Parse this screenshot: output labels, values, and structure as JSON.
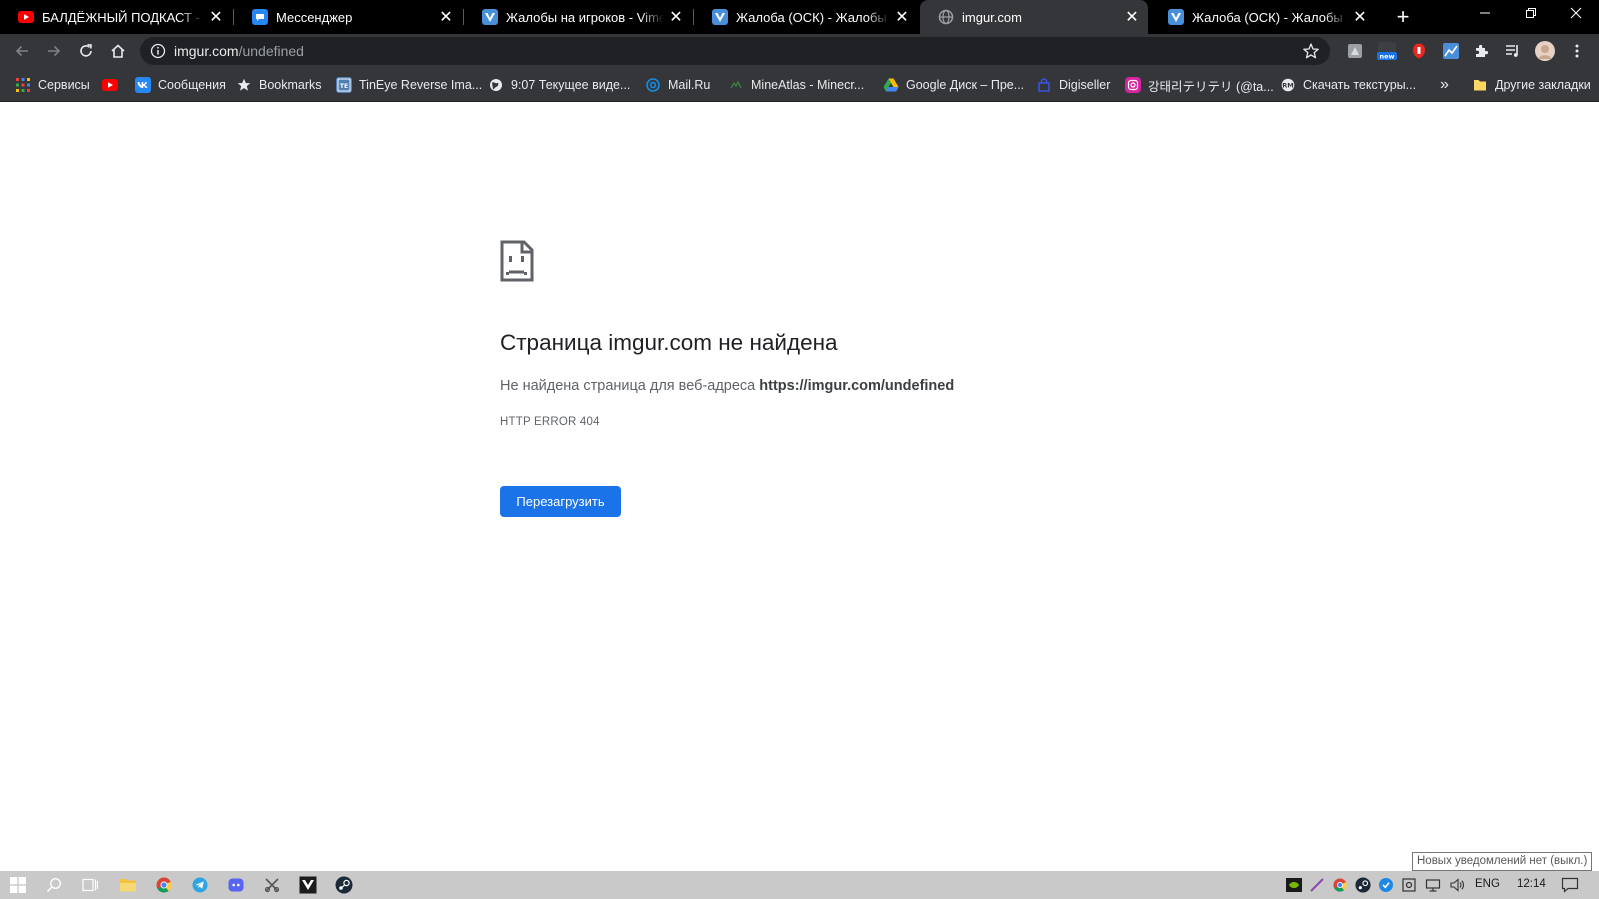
{
  "tabs": [
    {
      "title": "БАЛДЁЖНЫЙ ПОДКАСТ - Lida",
      "favicon": "youtube-icon",
      "active": false
    },
    {
      "title": "Мессенджер",
      "favicon": "messenger-icon",
      "active": false
    },
    {
      "title": "Жалобы на игроков - VimeWorld",
      "favicon": "vimeworld-icon",
      "active": false
    },
    {
      "title": "Жалоба (ОСК) - Жалобы на игроков",
      "favicon": "vimeworld-icon",
      "active": false
    },
    {
      "title": "imgur.com",
      "favicon": "globe-icon",
      "active": true
    },
    {
      "title": "Жалоба (ОСК) - Жалобы на игроков",
      "favicon": "vimeworld-icon",
      "active": false
    }
  ],
  "address": {
    "host": "imgur.com",
    "path": "/undefined"
  },
  "bookmarks": [
    {
      "label": "Сервисы",
      "icon": "apps-grid-icon"
    },
    {
      "label": "",
      "icon": "youtube-icon"
    },
    {
      "label": "Сообщения",
      "icon": "vk-icon"
    },
    {
      "label": "Bookmarks",
      "icon": "star-icon"
    },
    {
      "label": "TinEye Reverse Ima...",
      "icon": "tineye-icon"
    },
    {
      "label": "9:07 Текущее виде...",
      "icon": "globe-icon"
    },
    {
      "label": "Mail.Ru",
      "icon": "mailru-icon"
    },
    {
      "label": "MineAtlas - Minecr...",
      "icon": "mineatlas-icon"
    },
    {
      "label": "Google Диск – Пре...",
      "icon": "google-drive-icon"
    },
    {
      "label": "Digiseller",
      "icon": "digiseller-icon"
    },
    {
      "label": "강태리テリテリ (@ta...",
      "icon": "instagram-icon"
    },
    {
      "label": "Скачать текстуры...",
      "icon": "textures-icon"
    }
  ],
  "bookmarks_overflow": "»",
  "other_bookmarks": "Другие закладки",
  "error": {
    "title": "Страница imgur.com не найдена",
    "desc_prefix": "Не найдена страница для веб-адреса ",
    "desc_url": "https://imgur.com/undefined",
    "code": "HTTP ERROR 404",
    "reload_label": "Перезагрузить"
  },
  "tooltip": "Новых уведомлений нет (выкл.)",
  "taskbar": {
    "language": "ENG",
    "time": "12:14"
  },
  "colors": {
    "titlebar": "#000000",
    "toolbar": "#35363a",
    "omnibox": "#202124",
    "reload_button": "#1a73e8",
    "taskbar": "#c9c9c9"
  }
}
